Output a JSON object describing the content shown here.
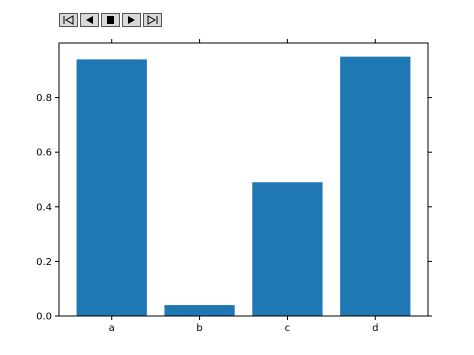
{
  "toolbar": {
    "buttons": [
      {
        "icon": "skip-back-icon"
      },
      {
        "icon": "play-reverse-icon"
      },
      {
        "icon": "stop-icon"
      },
      {
        "icon": "play-icon"
      },
      {
        "icon": "skip-forward-icon"
      }
    ]
  },
  "colors": {
    "bar": "#1f77b4",
    "axis": "#000000",
    "button_bg": "#d9d9d9"
  },
  "chart_data": {
    "type": "bar",
    "categories": [
      "a",
      "b",
      "c",
      "d"
    ],
    "values": [
      0.94,
      0.04,
      0.49,
      0.95
    ],
    "ylim": [
      0,
      1.0
    ],
    "yticks": [
      0.0,
      0.2,
      0.4,
      0.6,
      0.8
    ],
    "ytick_labels": [
      "0.0",
      "0.2",
      "0.4",
      "0.6",
      "0.8"
    ],
    "title": "",
    "xlabel": "",
    "ylabel": "",
    "grid": false,
    "legend": "none"
  }
}
